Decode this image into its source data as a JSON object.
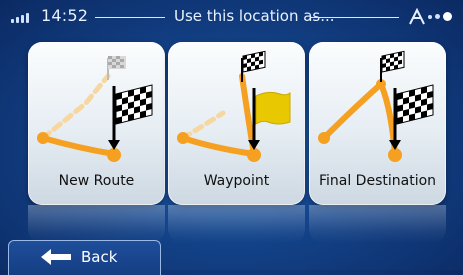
{
  "status_bar": {
    "time": "14:52",
    "title": "Use this location as..."
  },
  "options": [
    {
      "label": "New Route"
    },
    {
      "label": "Waypoint"
    },
    {
      "label": "Final Destination"
    }
  ],
  "back_button": {
    "label": "Back"
  },
  "colors": {
    "route_orange": "#f5a020",
    "flag_yellow": "#e8c800",
    "background_blue": "#134288"
  },
  "icons": [
    "signal-icon",
    "gps-icon",
    "checkered-flag-icon",
    "route-icon",
    "yellow-flag-icon",
    "back-arrow-icon"
  ]
}
